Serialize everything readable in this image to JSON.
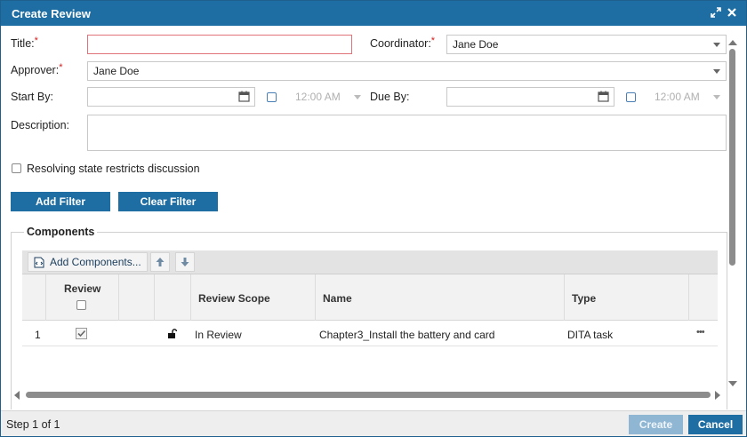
{
  "dialog": {
    "title": "Create Review",
    "colors": {
      "titlebar": "#1f6ea3",
      "accent": "#1f6ea3",
      "required": "#d31f1f"
    }
  },
  "form": {
    "title_label": "Title:",
    "title_value": "",
    "coordinator_label": "Coordinator:",
    "coordinator_value": "Jane Doe",
    "approver_label": "Approver:",
    "approver_value": "Jane Doe",
    "start_by_label": "Start By:",
    "start_time_placeholder": "12:00 AM",
    "due_by_label": "Due By:",
    "due_time_placeholder": "12:00 AM",
    "description_label": "Description:",
    "resolving_label": "Resolving state restricts discussion",
    "required_mark": "*"
  },
  "filters": {
    "add_filter": "Add Filter",
    "clear_filter": "Clear Filter"
  },
  "components": {
    "legend": "Components",
    "add_components": "Add Components...",
    "columns": {
      "review": "Review",
      "review_scope": "Review Scope",
      "name": "Name",
      "type": "Type"
    },
    "rows": [
      {
        "index": "1",
        "review_checked": true,
        "lock": "unlocked",
        "review_scope": "In Review",
        "name": "Chapter3_Install the battery and card",
        "type": "DITA task",
        "more": "•••"
      }
    ]
  },
  "footer": {
    "step": "Step 1 of 1",
    "create": "Create",
    "cancel": "Cancel"
  },
  "icons": [
    "expand-icon",
    "close-icon",
    "calendar-icon",
    "chevron-down-icon",
    "add-components-icon",
    "move-up-icon",
    "move-down-icon",
    "lock-open-icon",
    "more-icon"
  ]
}
